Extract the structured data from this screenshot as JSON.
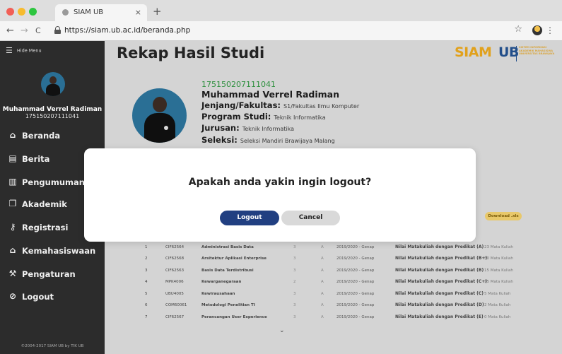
{
  "browser": {
    "tab_title": "SIAM UB",
    "tab_close": "×",
    "new_tab": "+",
    "url": "https://siam.ub.ac.id/beranda.php",
    "back": "←",
    "forward": "→",
    "reload": "C",
    "star": "☆",
    "menu": "⋮",
    "traffic_colors": [
      "#f25f56",
      "#f7bb2e",
      "#2dc63f"
    ]
  },
  "sidebar": {
    "hide_menu_icon": "☰",
    "hide_menu_label": "Hide Menu",
    "user_name": "Muhammad Verrel Radiman",
    "user_nim": "175150207111041",
    "items": [
      {
        "label": "Beranda",
        "icon": "home-icon",
        "glyph": "⌂"
      },
      {
        "label": "Berita",
        "icon": "newspaper-icon",
        "glyph": "▤"
      },
      {
        "label": "Pengumuman",
        "icon": "clipboard-icon",
        "glyph": "▥"
      },
      {
        "label": "Akademik",
        "icon": "copy-files-icon",
        "glyph": "❐"
      },
      {
        "label": "Registrasi",
        "icon": "key-icon",
        "glyph": "⚷"
      },
      {
        "label": "Kemahasiswaan",
        "icon": "graduation-cap-icon",
        "glyph": "⌂"
      },
      {
        "label": "Pengaturan",
        "icon": "wrench-icon",
        "glyph": "⚒"
      },
      {
        "label": "Logout",
        "icon": "logout-circle-icon",
        "glyph": "⊘"
      }
    ],
    "footer": "©2004-2017 SIAM UB by TIK UB"
  },
  "page": {
    "title": "Rekap Hasil Studi",
    "brand": {
      "siam": "SIAM",
      "ub": "UB",
      "subtitle": "SISTEM INFORMASI AKADEMIK MAHASISWA UNIVERSITAS BRAWIJAYA"
    },
    "profile": {
      "nim": "175150207111041",
      "name": "Muhammad Verrel Radiman",
      "jenjang_label": "Jenjang/Fakultas:",
      "jenjang_value": "S1/Fakultas Ilmu Komputer",
      "prodi_label": "Program Studi:",
      "prodi_value": "Teknik Informatika",
      "jurusan_label": "Jurusan:",
      "jurusan_value": "Teknik Informatika",
      "seleksi_label": "Seleksi:",
      "seleksi_value": "Seleksi Mandiri Brawijaya Malang"
    },
    "download_label": "Download .xls",
    "courses": [
      {
        "no": "1",
        "code": "CIF62564",
        "name": "Administrasi Basis Data",
        "sks": "3",
        "grade": "A",
        "sem": "2019/2020 - Genap",
        "pred": "Nilai Matakuliah dengan Predikat (A)",
        "count": "23 Mata Kuliah"
      },
      {
        "no": "2",
        "code": "CIF62568",
        "name": "Arsitektur Aplikasi Enterprise",
        "sks": "3",
        "grade": "A",
        "sem": "2019/2020 - Genap",
        "pred": "Nilai Matakuliah dengan Predikat (B+)",
        "count": "30 Mata Kuliah"
      },
      {
        "no": "3",
        "code": "CIF62563",
        "name": "Basis Data Terdistribusi",
        "sks": "3",
        "grade": "A",
        "sem": "2019/2020 - Genap",
        "pred": "Nilai Matakuliah dengan Predikat (B)",
        "count": "15 Mata Kuliah"
      },
      {
        "no": "4",
        "code": "MPK4006",
        "name": "Kewarganegaraan",
        "sks": "2",
        "grade": "A",
        "sem": "2019/2020 - Genap",
        "pred": "Nilai Matakuliah dengan Predikat (C+)",
        "count": "15 Mata Kuliah"
      },
      {
        "no": "5",
        "code": "UBU4005",
        "name": "Kewirausahaan",
        "sks": "3",
        "grade": "A",
        "sem": "2019/2020 - Genap",
        "pred": "Nilai Matakuliah dengan Predikat (C)",
        "count": "5 Mata Kuliah"
      },
      {
        "no": "6",
        "code": "COM60061",
        "name": "Metodologi Penelitian TI",
        "sks": "3",
        "grade": "A",
        "sem": "2019/2020 - Genap",
        "pred": "Nilai Matakuliah dengan Predikat (D)",
        "count": "2 Mata Kuliah"
      },
      {
        "no": "7",
        "code": "CIF62567",
        "name": "Perancangan User Experience",
        "sks": "3",
        "grade": "A",
        "sem": "2019/2020 - Genap",
        "pred": "Nilai Matakuliah dengan Predikat (E)",
        "count": "0 Mata Kuliah"
      }
    ],
    "scroll_down_glyph": "⌄"
  },
  "modal": {
    "question": "Apakah anda yakin ingin logout?",
    "logout_label": "Logout",
    "cancel_label": "Cancel"
  }
}
